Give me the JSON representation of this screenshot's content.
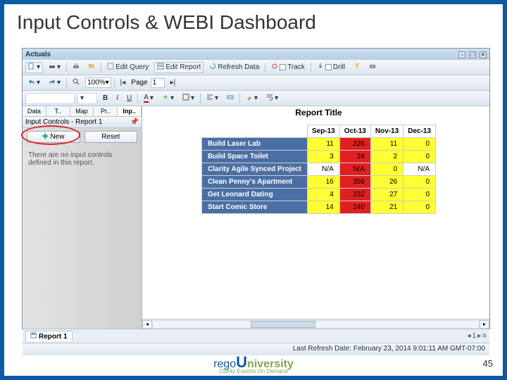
{
  "slide": {
    "title": "Input Controls & WEBI Dashboard",
    "page_number": "45"
  },
  "brand": {
    "rego": "rego",
    "U": "U",
    "niversity": "niversity",
    "tagline": "Clarity Experts On Demand"
  },
  "app": {
    "window_title": "Actuals",
    "status": "Last Refresh Date: February 23, 2014 9:01:11 AM GMT-07:00",
    "toolbar1": {
      "edit_query": "Edit Query",
      "edit_report": "Edit Report",
      "refresh": "Refresh Data",
      "track": "Track",
      "drill": "Drill"
    },
    "toolbar2": {
      "zoom": "100%",
      "page_label": "Page",
      "page_value": "1"
    },
    "left_panel": {
      "tabs": [
        "Data",
        "T..",
        "Map",
        "Pr..",
        "Inp.."
      ],
      "header": "Input Controls - Report 1",
      "new_btn": "New",
      "reset_btn": "Reset",
      "empty_text": "There are no input controls defined in this report."
    },
    "report": {
      "title": "Report Title",
      "columns": [
        "Sep-13",
        "Oct-13",
        "Nov-13",
        "Dec-13"
      ],
      "rows": [
        {
          "name": "Build Laser Lab",
          "cells": [
            {
              "v": "11",
              "c": "#ffff33"
            },
            {
              "v": "226",
              "c": "#e02020"
            },
            {
              "v": "11",
              "c": "#ffff33"
            },
            {
              "v": "0",
              "c": "#ffff33"
            }
          ]
        },
        {
          "name": "Build Space Toilet",
          "cells": [
            {
              "v": "3",
              "c": "#ffff33"
            },
            {
              "v": "24",
              "c": "#e02020"
            },
            {
              "v": "2",
              "c": "#ffff33"
            },
            {
              "v": "0",
              "c": "#ffff33"
            }
          ]
        },
        {
          "name": "Clarity Agile Synced Project",
          "cells": [
            {
              "v": "N/A",
              "c": "#ffffff"
            },
            {
              "v": "N/A",
              "c": "#e02020"
            },
            {
              "v": "0",
              "c": "#ffff33"
            },
            {
              "v": "N/A",
              "c": "#ffffff"
            }
          ]
        },
        {
          "name": "Clean Penny's Apartment",
          "cells": [
            {
              "v": "16",
              "c": "#ffff33"
            },
            {
              "v": "359",
              "c": "#e02020"
            },
            {
              "v": "26",
              "c": "#ffff33"
            },
            {
              "v": "0",
              "c": "#ffff33"
            }
          ]
        },
        {
          "name": "Get Leonard Dating",
          "cells": [
            {
              "v": "4",
              "c": "#ffff33"
            },
            {
              "v": "232",
              "c": "#e02020"
            },
            {
              "v": "27",
              "c": "#ffff33"
            },
            {
              "v": "0",
              "c": "#ffff33"
            }
          ]
        },
        {
          "name": "Start Comic Store",
          "cells": [
            {
              "v": "14",
              "c": "#ffff33"
            },
            {
              "v": "240",
              "c": "#e02020"
            },
            {
              "v": "21",
              "c": "#ffff33"
            },
            {
              "v": "0",
              "c": "#ffff33"
            }
          ]
        }
      ]
    },
    "bottom_tab": "Report 1",
    "bottom_nav": "1"
  }
}
